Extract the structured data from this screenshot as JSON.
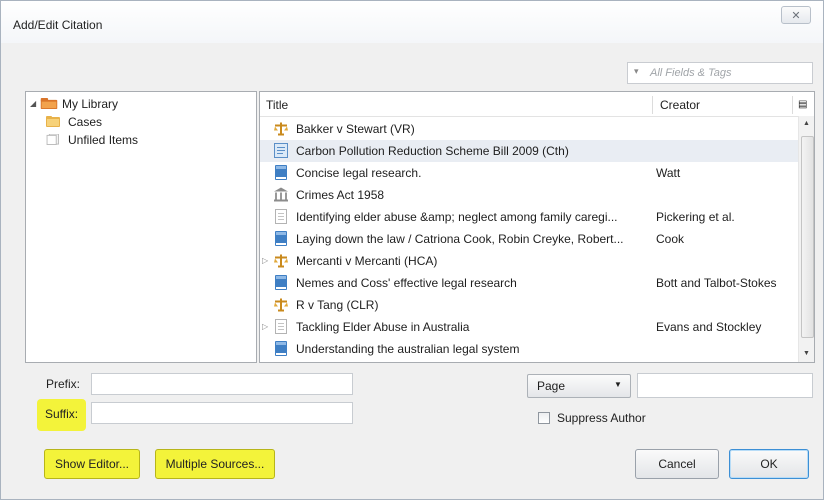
{
  "dialog": {
    "title": "Add/Edit Citation",
    "close_label": "X"
  },
  "search": {
    "placeholder": "All Fields & Tags",
    "icon": "magnifier-icon"
  },
  "library": {
    "root": "My Library",
    "children": [
      "Cases",
      "Unfiled Items"
    ]
  },
  "items": {
    "columns": {
      "title": "Title",
      "creator": "Creator"
    },
    "rows": [
      {
        "icon": "case-icon",
        "title": "Bakker v Stewart (VR)",
        "creator": ""
      },
      {
        "icon": "bill-icon",
        "title": "Carbon Pollution Reduction Scheme Bill 2009 (Cth)",
        "creator": ""
      },
      {
        "icon": "book-icon",
        "title": "Concise legal research.",
        "creator": "Watt"
      },
      {
        "icon": "statute-icon",
        "title": "Crimes Act 1958",
        "creator": ""
      },
      {
        "icon": "document-icon",
        "title": "Identifying elder abuse &amp; neglect among family caregi...",
        "creator": "Pickering et al."
      },
      {
        "icon": "book-icon",
        "title": "Laying down the law / Catriona Cook, Robin Creyke, Robert...",
        "creator": "Cook"
      },
      {
        "icon": "case-icon",
        "title": "Mercanti v Mercanti (HCA)",
        "creator": ""
      },
      {
        "icon": "book-icon",
        "title": "Nemes and Coss' effective legal research",
        "creator": "Bott and Talbot-Stokes"
      },
      {
        "icon": "case-icon",
        "title": "R v Tang (CLR)",
        "creator": ""
      },
      {
        "icon": "document-icon",
        "title": "Tackling Elder Abuse in Australia",
        "creator": "Evans and Stockley"
      },
      {
        "icon": "book-icon",
        "title": "Understanding the australian legal system",
        "creator": ""
      }
    ]
  },
  "form": {
    "prefix_label": "Prefix:",
    "suffix_label": "Suffix:",
    "prefix_value": "",
    "suffix_value": "",
    "locator_type": "Page",
    "locator_value": "",
    "suppress_author_label": "Suppress Author",
    "suppress_author_checked": false
  },
  "buttons": {
    "show_editor": "Show Editor...",
    "multiple_sources": "Multiple Sources...",
    "cancel": "Cancel",
    "ok": "OK"
  },
  "colors": {
    "highlight": "#f3f33a",
    "selected_row": "#e9edf3",
    "folder": "#e8b24a",
    "item_blue": "#4b8fd3"
  }
}
